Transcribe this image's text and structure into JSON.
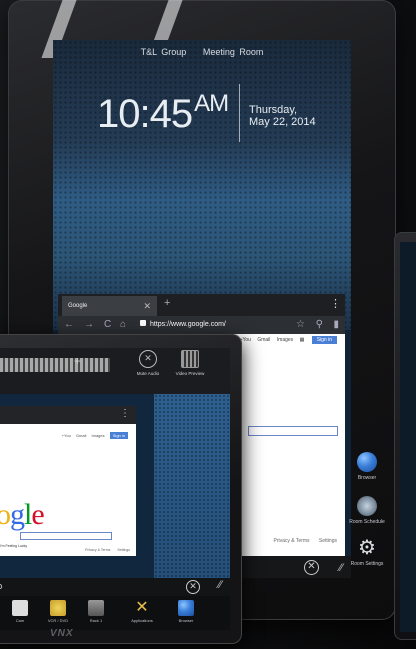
{
  "header": {
    "org": "T&L Group",
    "room": "Meeting Room"
  },
  "clock": {
    "time": "10:45",
    "ampm": "AM",
    "weekday": "Thursday,",
    "date": "May 22, 2014"
  },
  "browser_main": {
    "tab_title": "Google",
    "url": "https://www.google.com/",
    "links": [
      "+You",
      "Gmail",
      "Images"
    ],
    "sign_in": "Sign in",
    "footer": [
      "Privacy & Terms",
      "Settings"
    ]
  },
  "dock_main": [
    {
      "label": "Browser",
      "icon": "globe-icon"
    },
    {
      "label": "Room Schedule",
      "icon": "compass-icon"
    },
    {
      "label": "Room Settings",
      "icon": "gear-icon"
    }
  ],
  "small_tablet": {
    "top_buttons": [
      {
        "label": "Mute Audio",
        "icon": "close-circle-icon"
      },
      {
        "label": "Video Preview",
        "icon": "film-icon"
      }
    ],
    "google_partial": "ogle",
    "links": [
      "+You",
      "Gmail",
      "Images"
    ],
    "sign_in": "Sign in",
    "search_button": "I'm Feeling Lucky",
    "footer": [
      "Privacy & Terms",
      "Settings"
    ],
    "dock": [
      {
        "label": "Cam",
        "icon": "camera-icon"
      },
      {
        "label": "VCR / DVD",
        "icon": "disc-icon"
      },
      {
        "label": "Rack 1",
        "icon": "rack-icon"
      },
      {
        "label": "Applications",
        "icon": "tools-icon"
      },
      {
        "label": "Browser",
        "icon": "globe-icon"
      }
    ]
  },
  "brand": "VNX"
}
